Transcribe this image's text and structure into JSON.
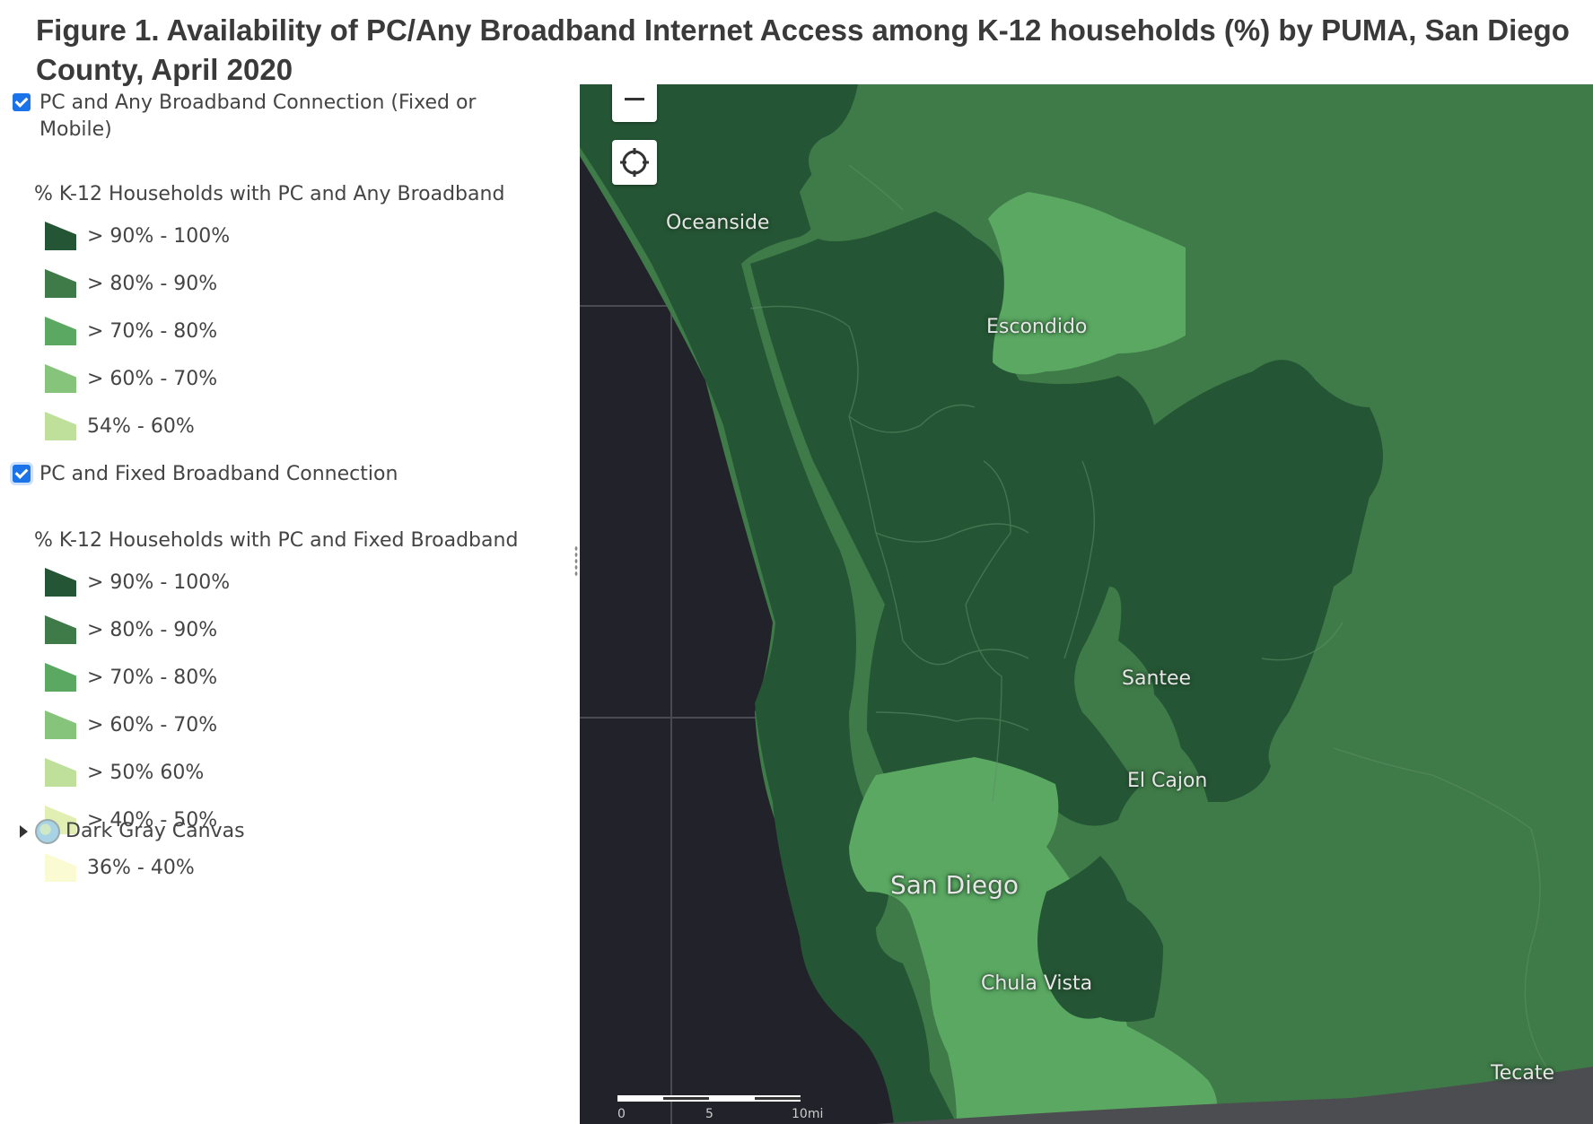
{
  "figure": {
    "title": "Figure 1. Availability of PC/Any Broadband Internet Access among K-12 households (%) by PUMA, San Diego County, April 2020"
  },
  "legend": {
    "layers": [
      {
        "label": "PC and Any Broadband Connection (Fixed or Mobile)",
        "checked": true,
        "heading": "% K-12 Households with PC and Any Broadband",
        "classes": [
          {
            "label": "> 90% - 100%",
            "color": "#245534"
          },
          {
            "label": "> 80% - 90%",
            "color": "#3f7b48"
          },
          {
            "label": "> 70% - 80%",
            "color": "#5aa862"
          },
          {
            "label": "> 60% - 70%",
            "color": "#86c37b"
          },
          {
            "label": "54% - 60%",
            "color": "#bfe09b"
          }
        ]
      },
      {
        "label": "PC and Fixed Broadband Connection",
        "checked": true,
        "heading": "% K-12 Households with PC and Fixed Broadband",
        "classes": [
          {
            "label": "> 90% - 100%",
            "color": "#245534"
          },
          {
            "label": "> 80% - 90%",
            "color": "#3f7b48"
          },
          {
            "label": "> 70% - 80%",
            "color": "#5aa862"
          },
          {
            "label": "> 60% - 70%",
            "color": "#86c37b"
          },
          {
            "label": "> 50% 60%",
            "color": "#bfe09b"
          },
          {
            "label": "> 40% - 50%",
            "color": "#e2efb3"
          },
          {
            "label": "36% - 40%",
            "color": "#fbfbd3"
          }
        ]
      }
    ],
    "basemap": {
      "label": "Dark Gray Canvas",
      "icon": "globe-icon"
    }
  },
  "map": {
    "controls": {
      "zoom_out_icon": "minus-icon",
      "locate_icon": "crosshair-icon"
    },
    "place_labels": {
      "oceanside": "Oceanside",
      "escondido": "Escondido",
      "santee": "Santee",
      "el_cajon": "El Cajon",
      "san_diego": "San Diego",
      "chula_vista": "Chula Vista",
      "tecate": "Tecate"
    },
    "scale_bar": {
      "label_0": "0",
      "label_5": "5",
      "label_10": "10mi"
    },
    "colors": {
      "ocean": "#22232a",
      "class_90_100": "#245534",
      "class_80_90": "#3f7b48",
      "class_70_80": "#5aa862"
    }
  }
}
